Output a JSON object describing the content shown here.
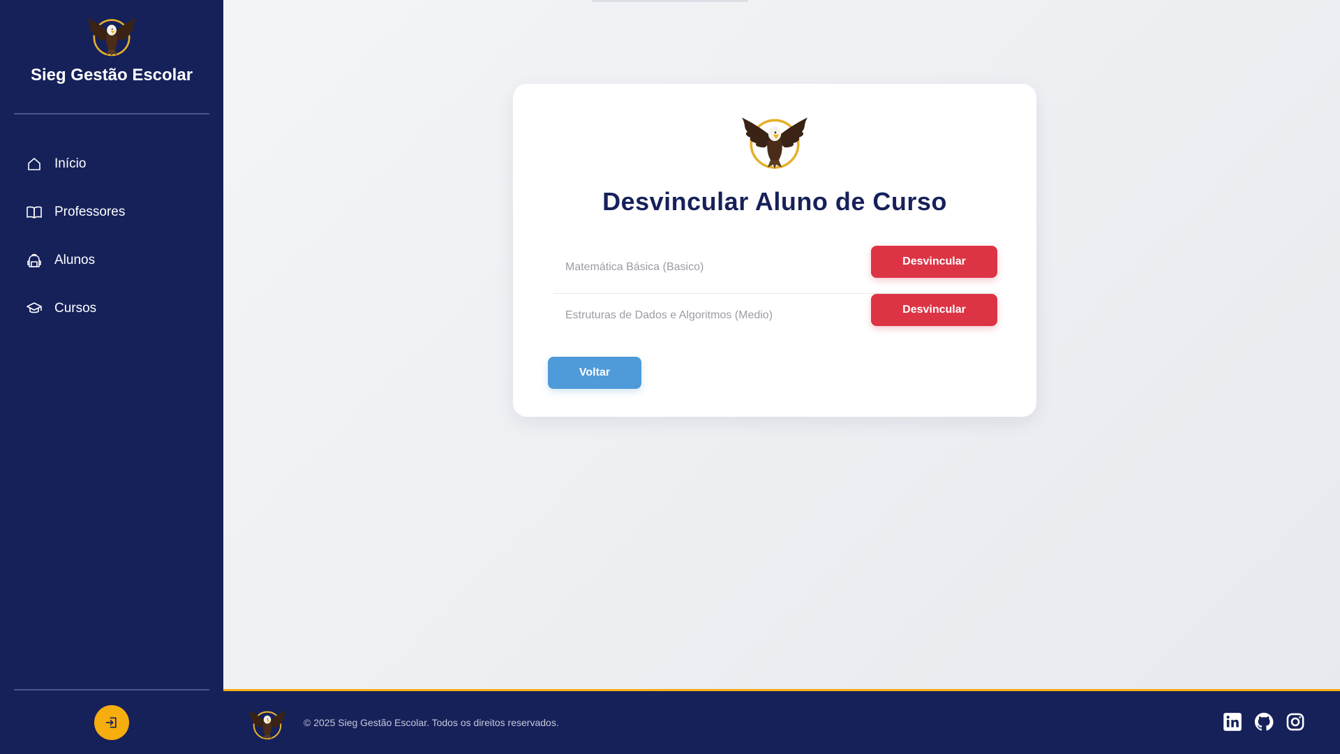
{
  "app": {
    "title": "Sieg Gestão Escolar"
  },
  "sidebar": {
    "items": [
      {
        "label": "Início",
        "icon": "home-icon"
      },
      {
        "label": "Professores",
        "icon": "book-icon"
      },
      {
        "label": "Alunos",
        "icon": "backpack-icon"
      },
      {
        "label": "Cursos",
        "icon": "graduation-cap-icon"
      }
    ],
    "logout_icon": "logout-icon"
  },
  "page": {
    "title": "Desvincular Aluno de Curso",
    "courses": [
      {
        "name": "Matemática Básica (Basico)",
        "action_label": "Desvincular"
      },
      {
        "name": "Estruturas de Dados e Algoritmos (Medio)",
        "action_label": "Desvincular"
      }
    ],
    "back_label": "Voltar"
  },
  "footer": {
    "copyright": "© 2025 Sieg Gestão Escolar. Todos os direitos reservados.",
    "social": [
      "linkedin-icon",
      "github-icon",
      "instagram-icon"
    ]
  },
  "colors": {
    "primary_navy": "#16215a",
    "accent_gold": "#f6ad0e",
    "danger_red": "#dc3445",
    "back_blue": "#4f9ad9"
  }
}
